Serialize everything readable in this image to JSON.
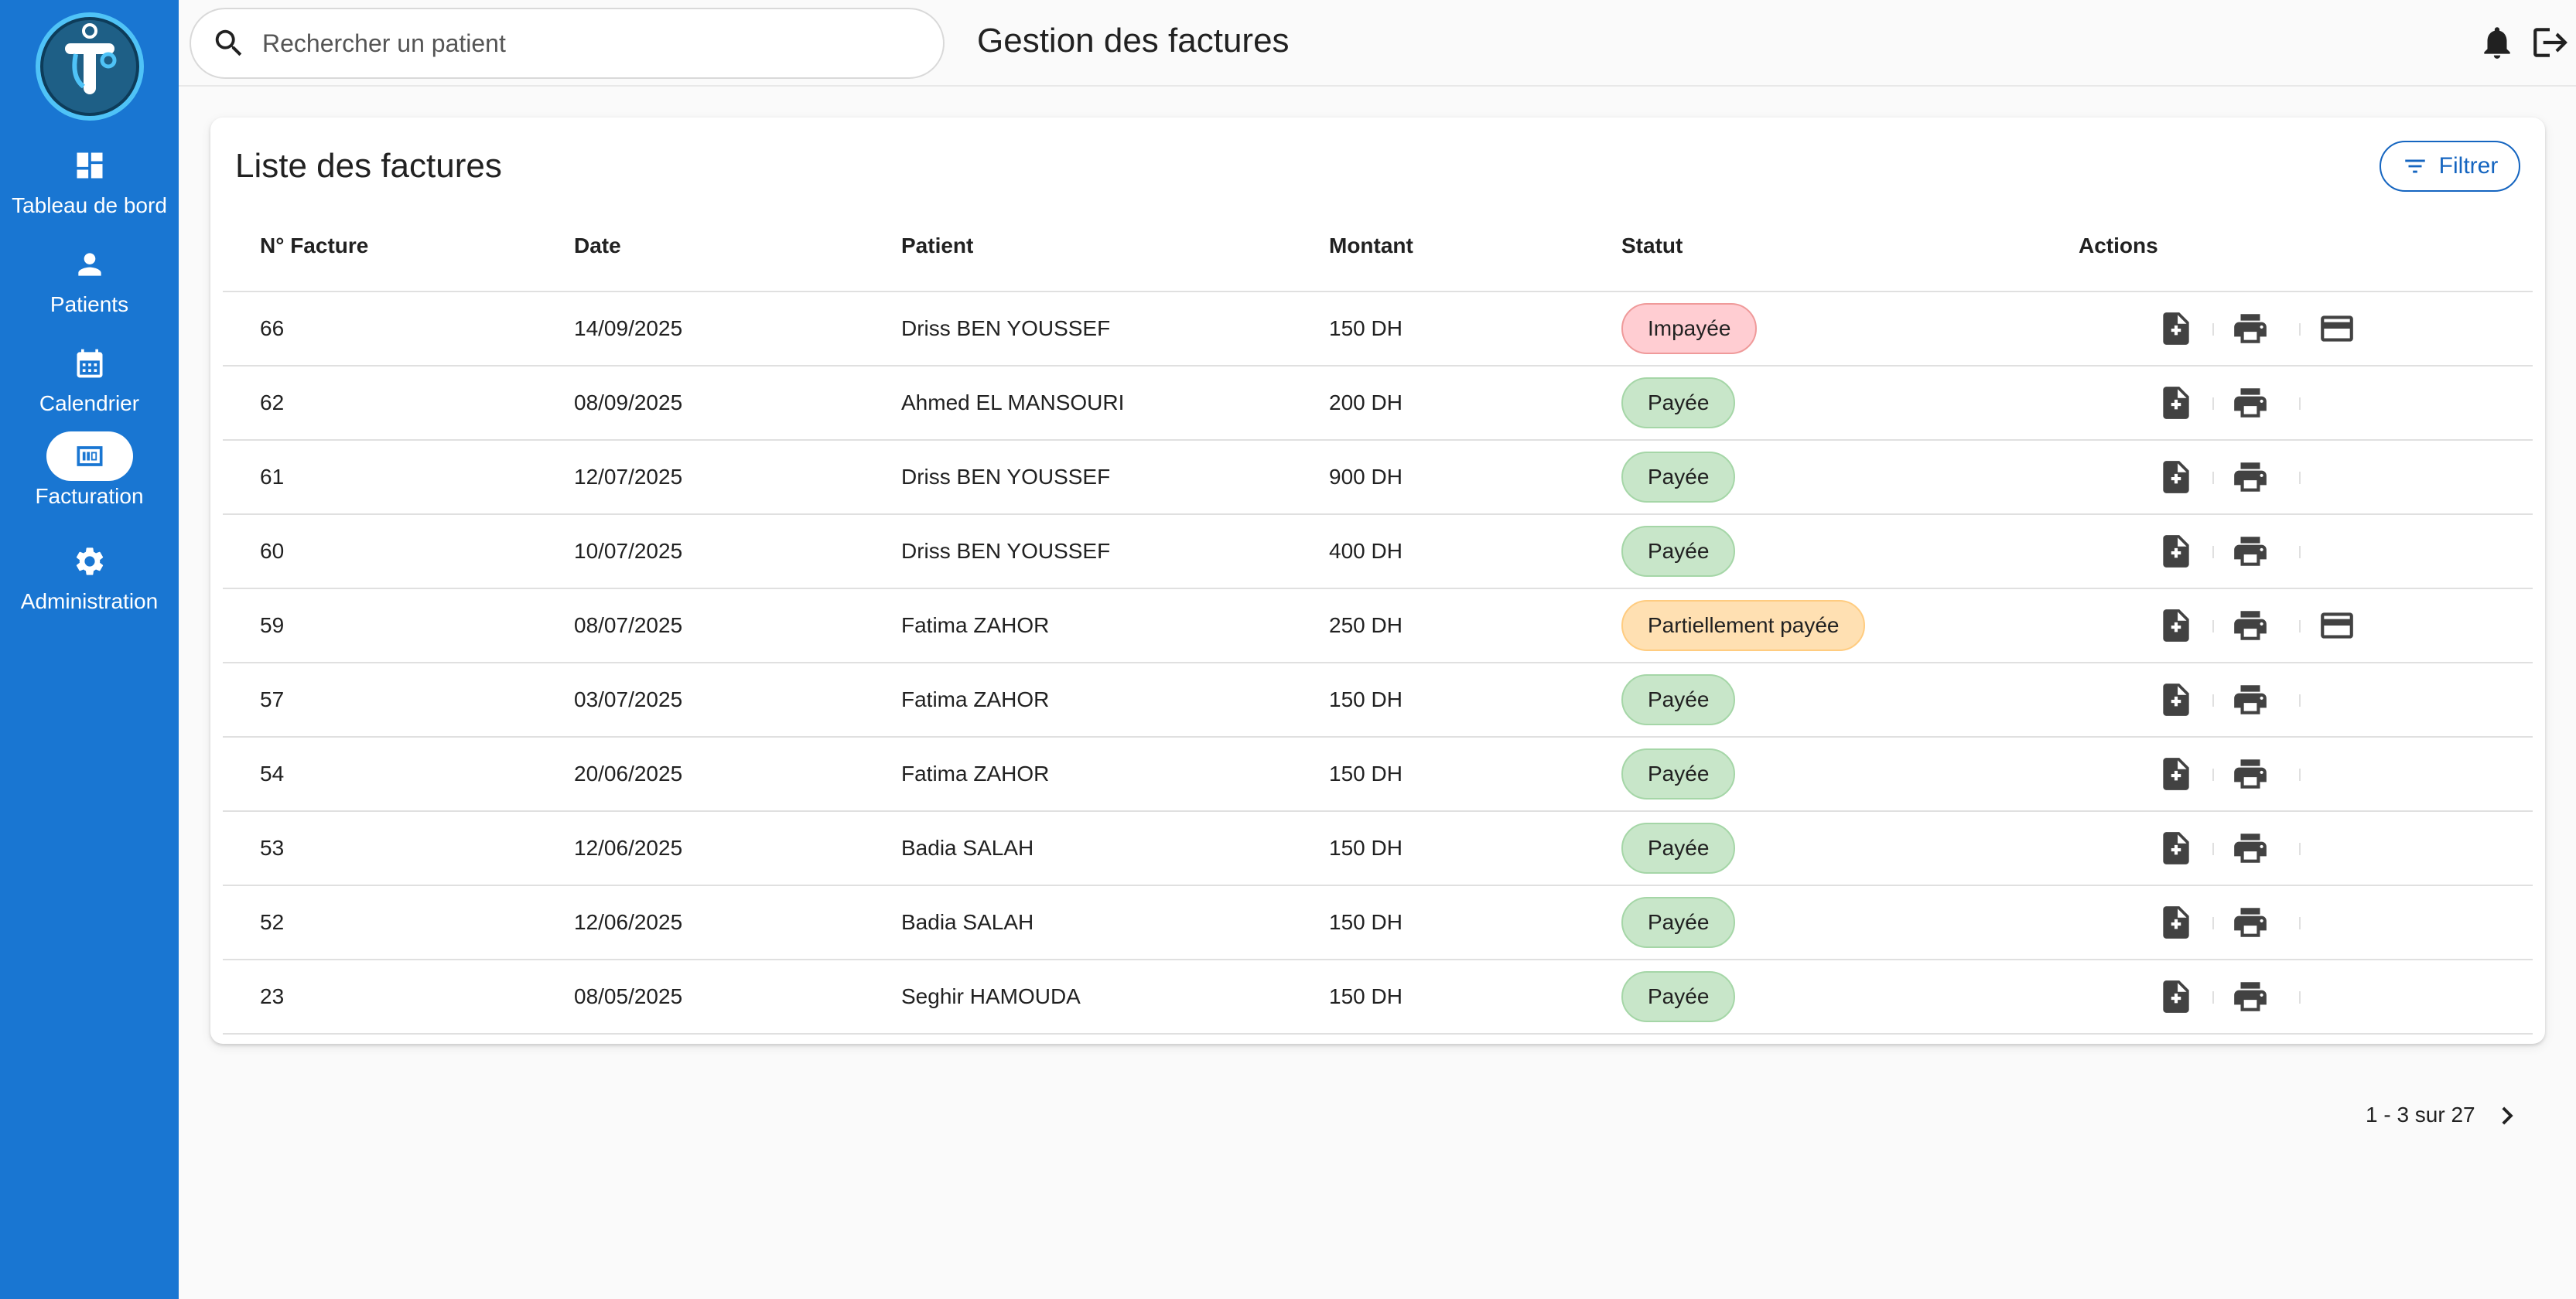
{
  "sidebar": {
    "items": [
      {
        "label": "Tableau de bord",
        "icon": "dashboard-icon"
      },
      {
        "label": "Patients",
        "icon": "person-icon"
      },
      {
        "label": "Calendrier",
        "icon": "calendar-icon"
      },
      {
        "label": "Facturation",
        "icon": "billing-icon",
        "active": true
      },
      {
        "label": "Administration",
        "icon": "gear-icon"
      }
    ]
  },
  "header": {
    "search_placeholder": "Rechercher un patient",
    "title": "Gestion des factures"
  },
  "card": {
    "title": "Liste des factures",
    "filter_label": "Filtrer"
  },
  "table": {
    "columns": [
      "N° Facture",
      "Date",
      "Patient",
      "Montant",
      "Statut",
      "Actions"
    ],
    "rows": [
      {
        "num": "66",
        "date": "14/09/2025",
        "patient": "Driss BEN YOUSSEF",
        "amount": "150 DH",
        "status": "Impayée",
        "status_type": "unpaid",
        "pay": true
      },
      {
        "num": "62",
        "date": "08/09/2025",
        "patient": "Ahmed EL MANSOURI",
        "amount": "200 DH",
        "status": "Payée",
        "status_type": "paid",
        "pay": false
      },
      {
        "num": "61",
        "date": "12/07/2025",
        "patient": "Driss BEN YOUSSEF",
        "amount": "900 DH",
        "status": "Payée",
        "status_type": "paid",
        "pay": false
      },
      {
        "num": "60",
        "date": "10/07/2025",
        "patient": "Driss BEN YOUSSEF",
        "amount": "400 DH",
        "status": "Payée",
        "status_type": "paid",
        "pay": false
      },
      {
        "num": "59",
        "date": "08/07/2025",
        "patient": "Fatima ZAHOR",
        "amount": "250 DH",
        "status": "Partiellement payée",
        "status_type": "partial",
        "pay": true
      },
      {
        "num": "57",
        "date": "03/07/2025",
        "patient": "Fatima ZAHOR",
        "amount": "150 DH",
        "status": "Payée",
        "status_type": "paid",
        "pay": false
      },
      {
        "num": "54",
        "date": "20/06/2025",
        "patient": "Fatima ZAHOR",
        "amount": "150 DH",
        "status": "Payée",
        "status_type": "paid",
        "pay": false
      },
      {
        "num": "53",
        "date": "12/06/2025",
        "patient": "Badia SALAH",
        "amount": "150 DH",
        "status": "Payée",
        "status_type": "paid",
        "pay": false
      },
      {
        "num": "52",
        "date": "12/06/2025",
        "patient": "Badia SALAH",
        "amount": "150 DH",
        "status": "Payée",
        "status_type": "paid",
        "pay": false
      },
      {
        "num": "23",
        "date": "08/05/2025",
        "patient": "Seghir HAMOUDA",
        "amount": "150 DH",
        "status": "Payée",
        "status_type": "paid",
        "pay": false
      }
    ]
  },
  "pagination": {
    "label": "1 - 3 sur 27"
  },
  "colors": {
    "primary": "#1976d2",
    "paid": "#c8e6c9",
    "unpaid": "#ffcdd2",
    "partial": "#ffe0b2"
  }
}
